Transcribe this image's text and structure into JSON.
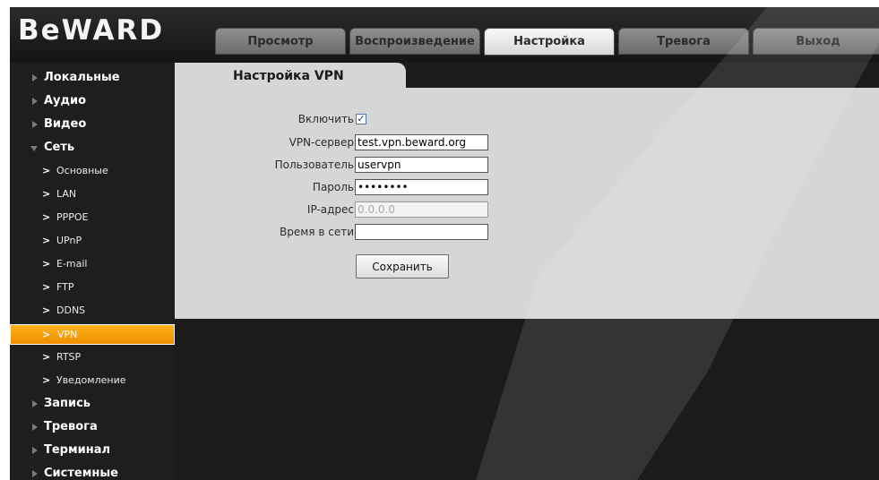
{
  "brand": {
    "logo_text": "BeWARD"
  },
  "tabs": [
    {
      "label": "Просмотр",
      "active": false
    },
    {
      "label": "Воспроизведение",
      "active": false
    },
    {
      "label": "Настройка",
      "active": true
    },
    {
      "label": "Тревога",
      "active": false
    },
    {
      "label": "Выход",
      "active": false
    }
  ],
  "sidebar": {
    "items": [
      {
        "label": "Локальные",
        "level": "main",
        "expanded": false
      },
      {
        "label": "Аудио",
        "level": "main",
        "expanded": false
      },
      {
        "label": "Видео",
        "level": "main",
        "expanded": false
      },
      {
        "label": "Сеть",
        "level": "main",
        "expanded": true
      },
      {
        "label": "Основные",
        "level": "sub"
      },
      {
        "label": "LAN",
        "level": "sub"
      },
      {
        "label": "PPPOE",
        "level": "sub"
      },
      {
        "label": "UPnP",
        "level": "sub"
      },
      {
        "label": "E-mail",
        "level": "sub"
      },
      {
        "label": "FTP",
        "level": "sub"
      },
      {
        "label": "DDNS",
        "level": "sub"
      },
      {
        "label": "VPN",
        "level": "sub",
        "active": true
      },
      {
        "label": "RTSP",
        "level": "sub"
      },
      {
        "label": "Уведомление",
        "level": "sub"
      },
      {
        "label": "Запись",
        "level": "main",
        "expanded": false
      },
      {
        "label": "Тревога",
        "level": "main",
        "expanded": false
      },
      {
        "label": "Терминал",
        "level": "main",
        "expanded": false
      },
      {
        "label": "Системные",
        "level": "main",
        "expanded": false
      }
    ]
  },
  "panel": {
    "title": "Настройка VPN",
    "enable": {
      "label": "Включить",
      "checked": true
    },
    "server": {
      "label": "VPN-сервер",
      "value": "test.vpn.beward.org"
    },
    "user": {
      "label": "Пользователь",
      "value": "uservpn"
    },
    "password": {
      "label": "Пароль",
      "value": "12345678"
    },
    "ip": {
      "label": "IP-адрес",
      "value": "0.0.0.0"
    },
    "online_time": {
      "label": "Время в сети",
      "value": ""
    },
    "save_label": "Сохранить"
  },
  "colors": {
    "background": "#1b1b1b",
    "panel": "#d6d6d6",
    "active_item": "#f5a000",
    "active_tab": "#eeeeee"
  }
}
